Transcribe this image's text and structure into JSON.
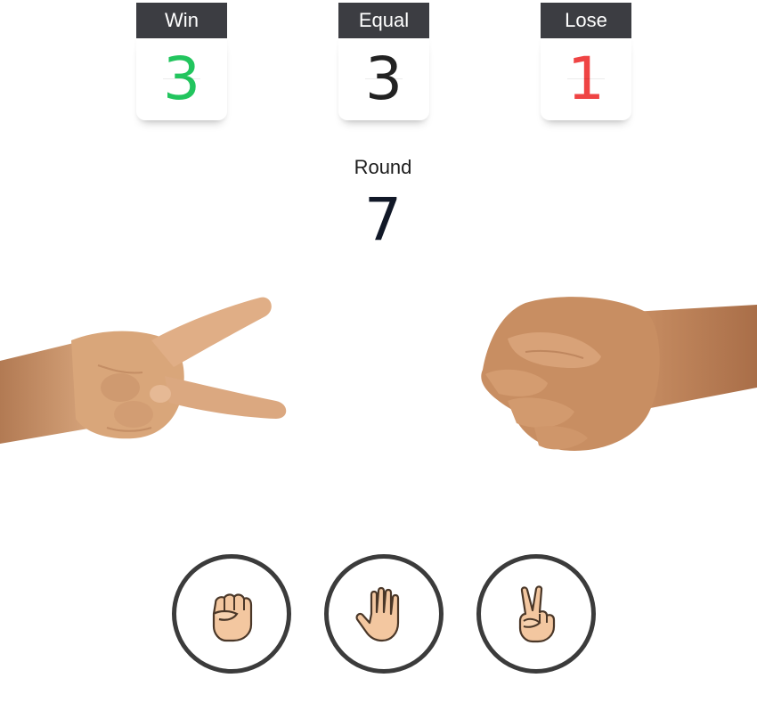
{
  "scores": {
    "win": {
      "label": "Win",
      "value": "3",
      "color": "#22c55e"
    },
    "equal": {
      "label": "Equal",
      "value": "3",
      "color": "#222222"
    },
    "lose": {
      "label": "Lose",
      "value": "1",
      "color": "#ef4444"
    }
  },
  "round": {
    "label": "Round",
    "value": "7"
  },
  "hands": {
    "player": {
      "gesture": "scissors",
      "icon": "hand-scissors-photo"
    },
    "opponent": {
      "gesture": "rock",
      "icon": "hand-rock-photo"
    }
  },
  "choices": [
    {
      "name": "rock",
      "icon": "fist-emoji-icon"
    },
    {
      "name": "paper",
      "icon": "open-hand-emoji-icon"
    },
    {
      "name": "scissors",
      "icon": "victory-hand-emoji-icon"
    }
  ],
  "colors": {
    "label_bg": "#3c3d42",
    "button_border": "#3b3b3b",
    "skin": "#d9a67a",
    "emoji_skin": "#f3c7a0"
  }
}
